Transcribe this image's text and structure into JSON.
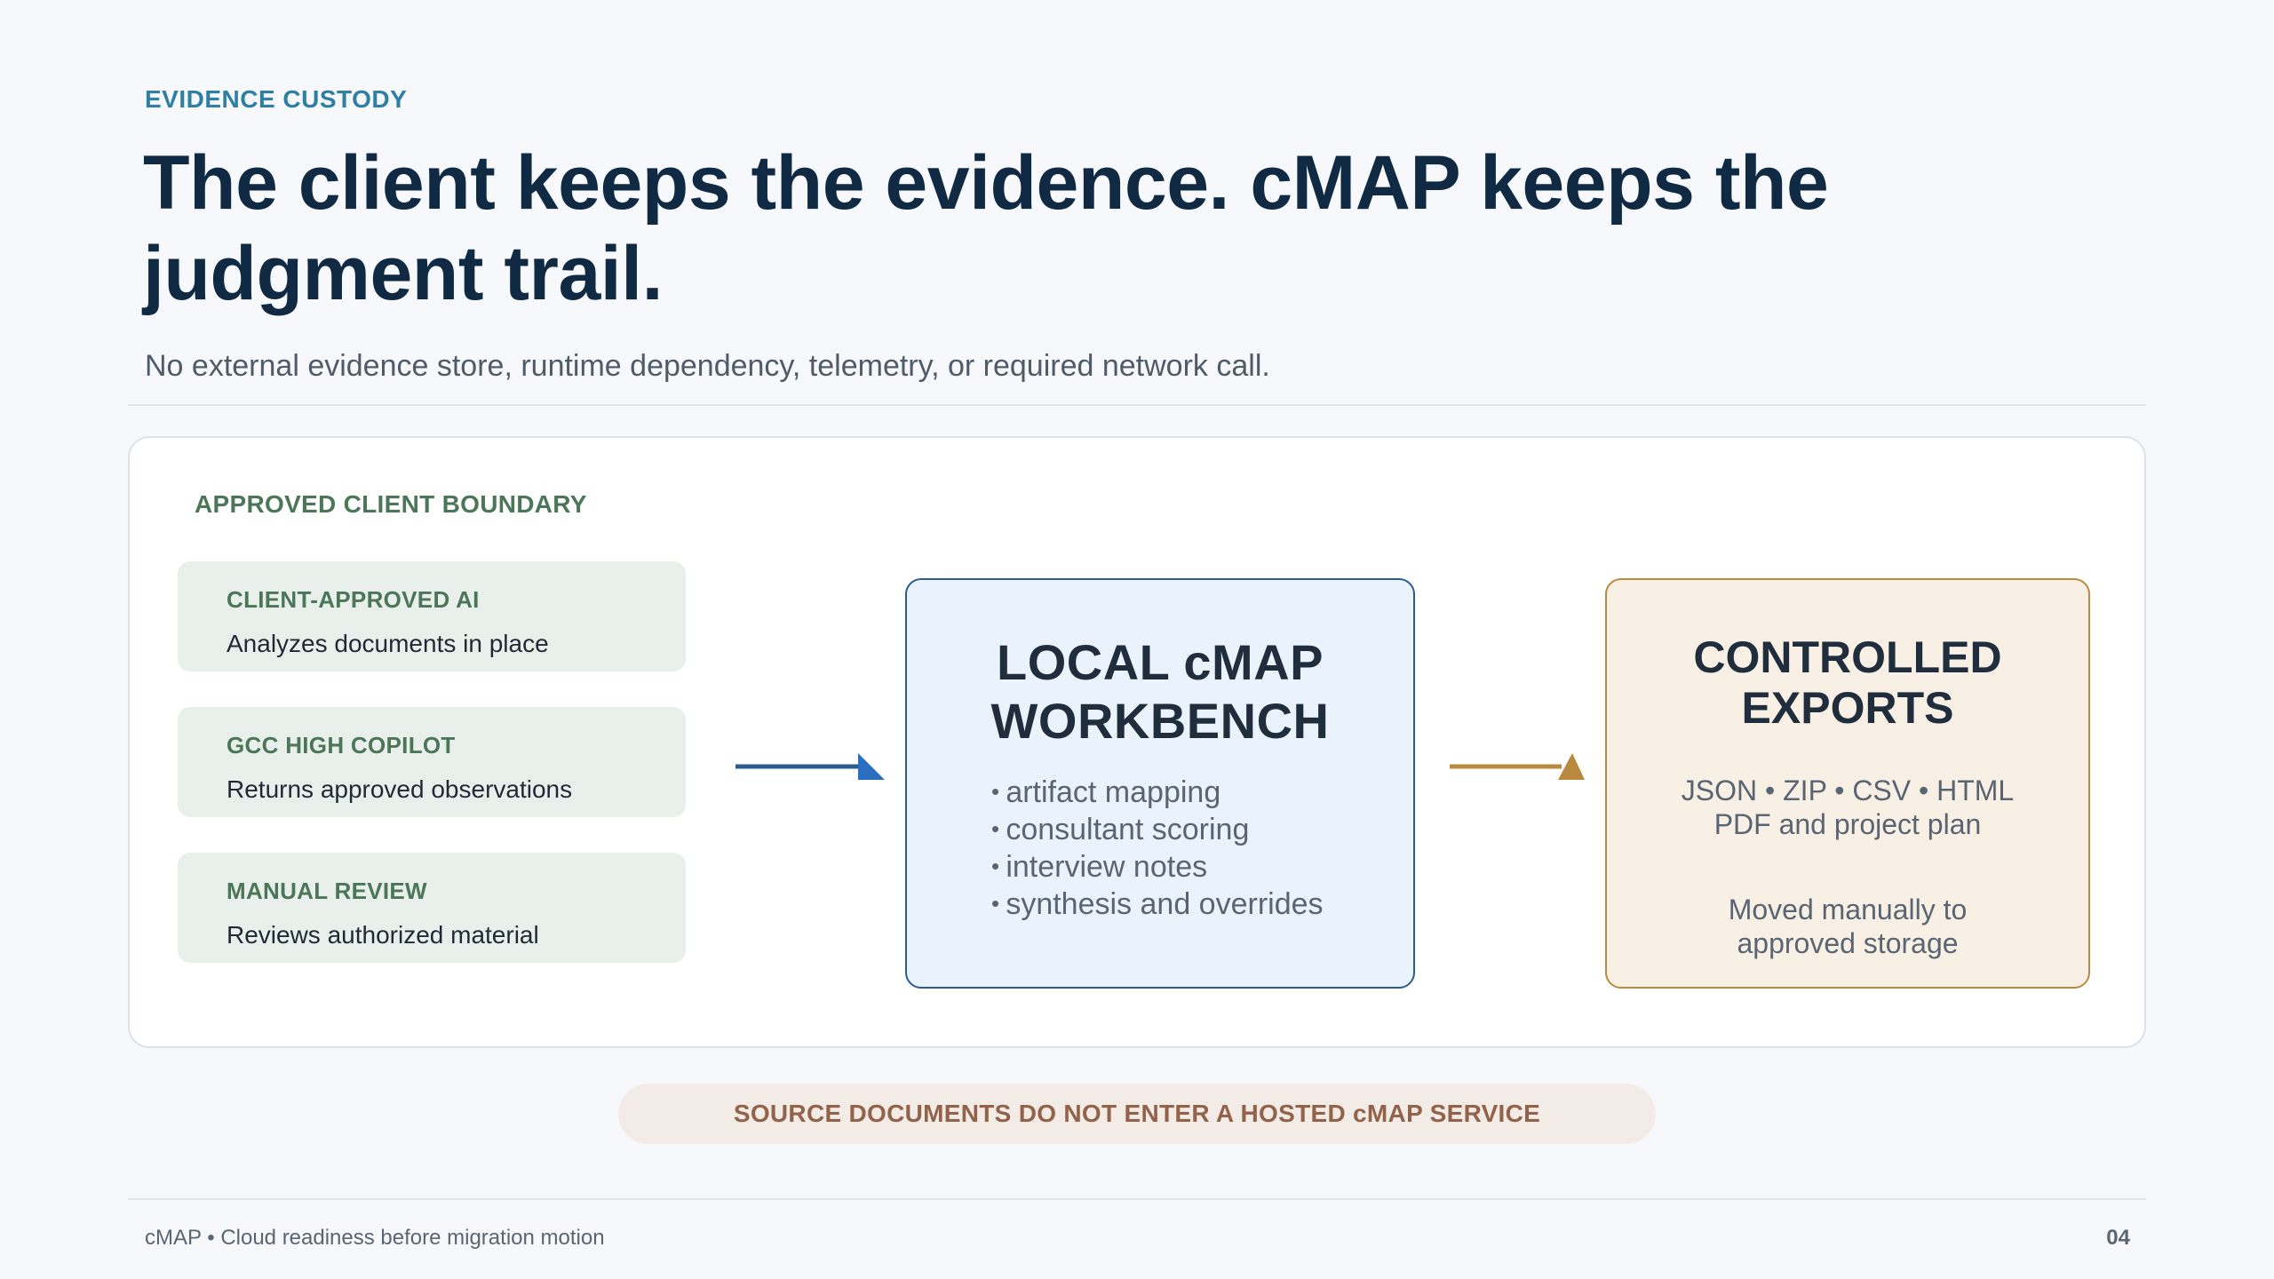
{
  "header": {
    "eyebrow": "EVIDENCE CUSTODY",
    "title": "The client keeps the evidence. cMAP keeps the judgment trail.",
    "subtitle": "No external evidence store, runtime dependency, telemetry, or required network call."
  },
  "boundary": {
    "label": "APPROVED CLIENT BOUNDARY",
    "sources": [
      {
        "title": "CLIENT-APPROVED AI",
        "desc": "Analyzes documents in place"
      },
      {
        "title": "GCC HIGH COPILOT",
        "desc": "Returns approved observations"
      },
      {
        "title": "MANUAL REVIEW",
        "desc": "Reviews authorized material"
      }
    ]
  },
  "workbench": {
    "title_line1": "LOCAL cMAP",
    "title_line2": "WORKBENCH",
    "items": [
      "artifact mapping",
      "consultant scoring",
      "interview notes",
      "synthesis and overrides"
    ]
  },
  "exports": {
    "title_line1": "CONTROLLED",
    "title_line2": "EXPORTS",
    "formats_line1": "JSON • ZIP • CSV • HTML",
    "formats_line2": "PDF and project plan",
    "note_line1": "Moved manually to",
    "note_line2": "approved storage"
  },
  "notice": "SOURCE DOCUMENTS DO NOT ENTER A HOSTED cMAP SERVICE",
  "footer": {
    "left": "cMAP • Cloud readiness before migration motion",
    "page": "04"
  },
  "colors": {
    "accent_blue": "#2c5c8f",
    "accent_gold": "#b8893f",
    "boundary_green": "#4b7658",
    "notice_brown": "#92634a"
  }
}
